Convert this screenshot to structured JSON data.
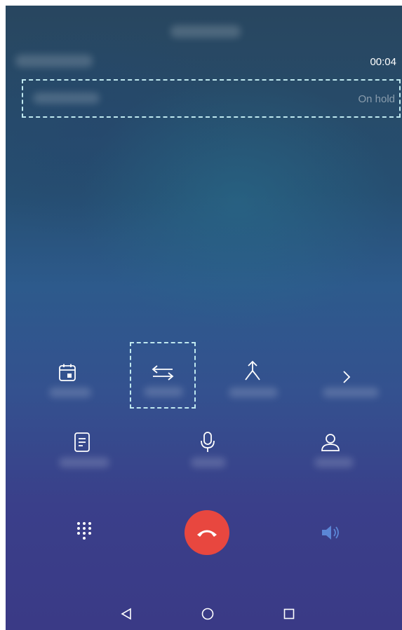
{
  "call": {
    "duration": "00:04",
    "held_call_status": "On hold"
  },
  "icons": {
    "more_options": "calendar-hold-icon",
    "swap_calls": "swap-icon",
    "merge_calls": "merge-icon",
    "more": "chevron-right-icon",
    "notes": "notes-icon",
    "mute": "microphone-icon",
    "contacts": "contact-icon",
    "dialpad": "dialpad-icon",
    "end_call": "hang-up-icon",
    "speaker": "speaker-icon",
    "nav_back": "back-triangle-icon",
    "nav_home": "home-circle-icon",
    "nav_recents": "recents-square-icon"
  },
  "colors": {
    "end_call": "#e8473f",
    "highlight_border": "#bfe8ef",
    "speaker_active": "#5b86d6"
  }
}
